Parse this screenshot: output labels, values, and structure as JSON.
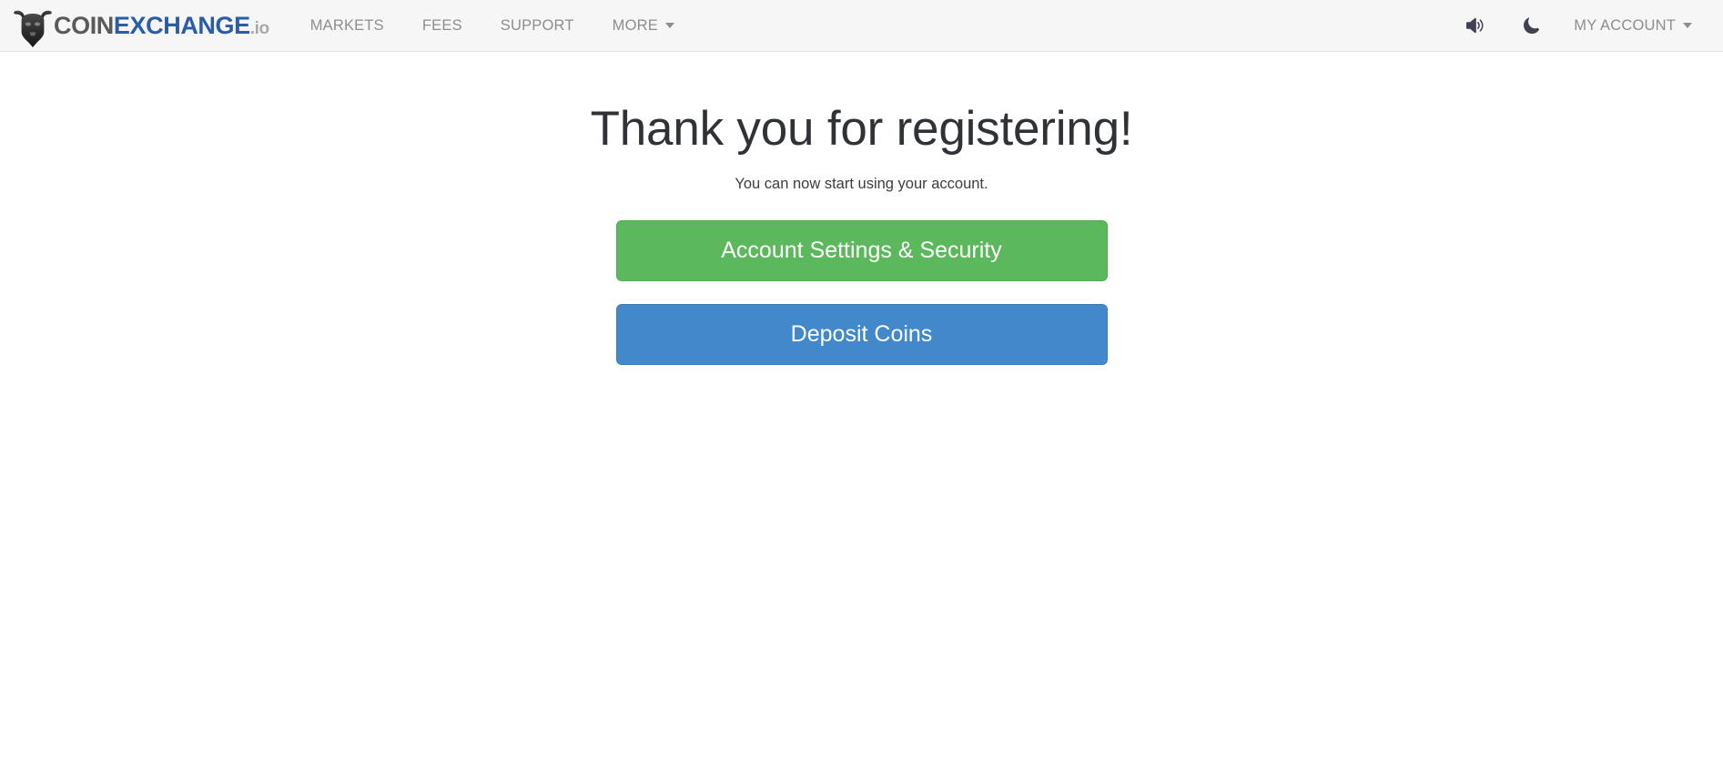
{
  "navbar": {
    "brand": {
      "icon": "bull-logo-icon",
      "part_primary": "COIN",
      "part_accent": "EXCHANGE",
      "part_suffix": ".io",
      "color_primary": "#5a5a5a",
      "color_accent": "#2a5ca8",
      "color_suffix": "#a8a8ac"
    },
    "links": [
      {
        "label": "MARKETS",
        "has_caret": false
      },
      {
        "label": "FEES",
        "has_caret": false
      },
      {
        "label": "SUPPORT",
        "has_caret": false
      },
      {
        "label": "MORE",
        "has_caret": true
      }
    ],
    "right": {
      "sound_icon": "volume-up-icon",
      "theme_icon": "moon-icon",
      "account_label": "MY ACCOUNT",
      "account_has_caret": true
    },
    "background": "#f6f6f7",
    "border_color": "#e4e4e6",
    "link_color": "#8d8d8d"
  },
  "main": {
    "title": "Thank you for registering!",
    "subtitle": "You can now start using your account.",
    "buttons": [
      {
        "label": "Account Settings & Security",
        "style": "success",
        "color": "#5cb85c"
      },
      {
        "label": "Deposit Coins",
        "style": "primary",
        "color": "#4189ca"
      }
    ]
  }
}
